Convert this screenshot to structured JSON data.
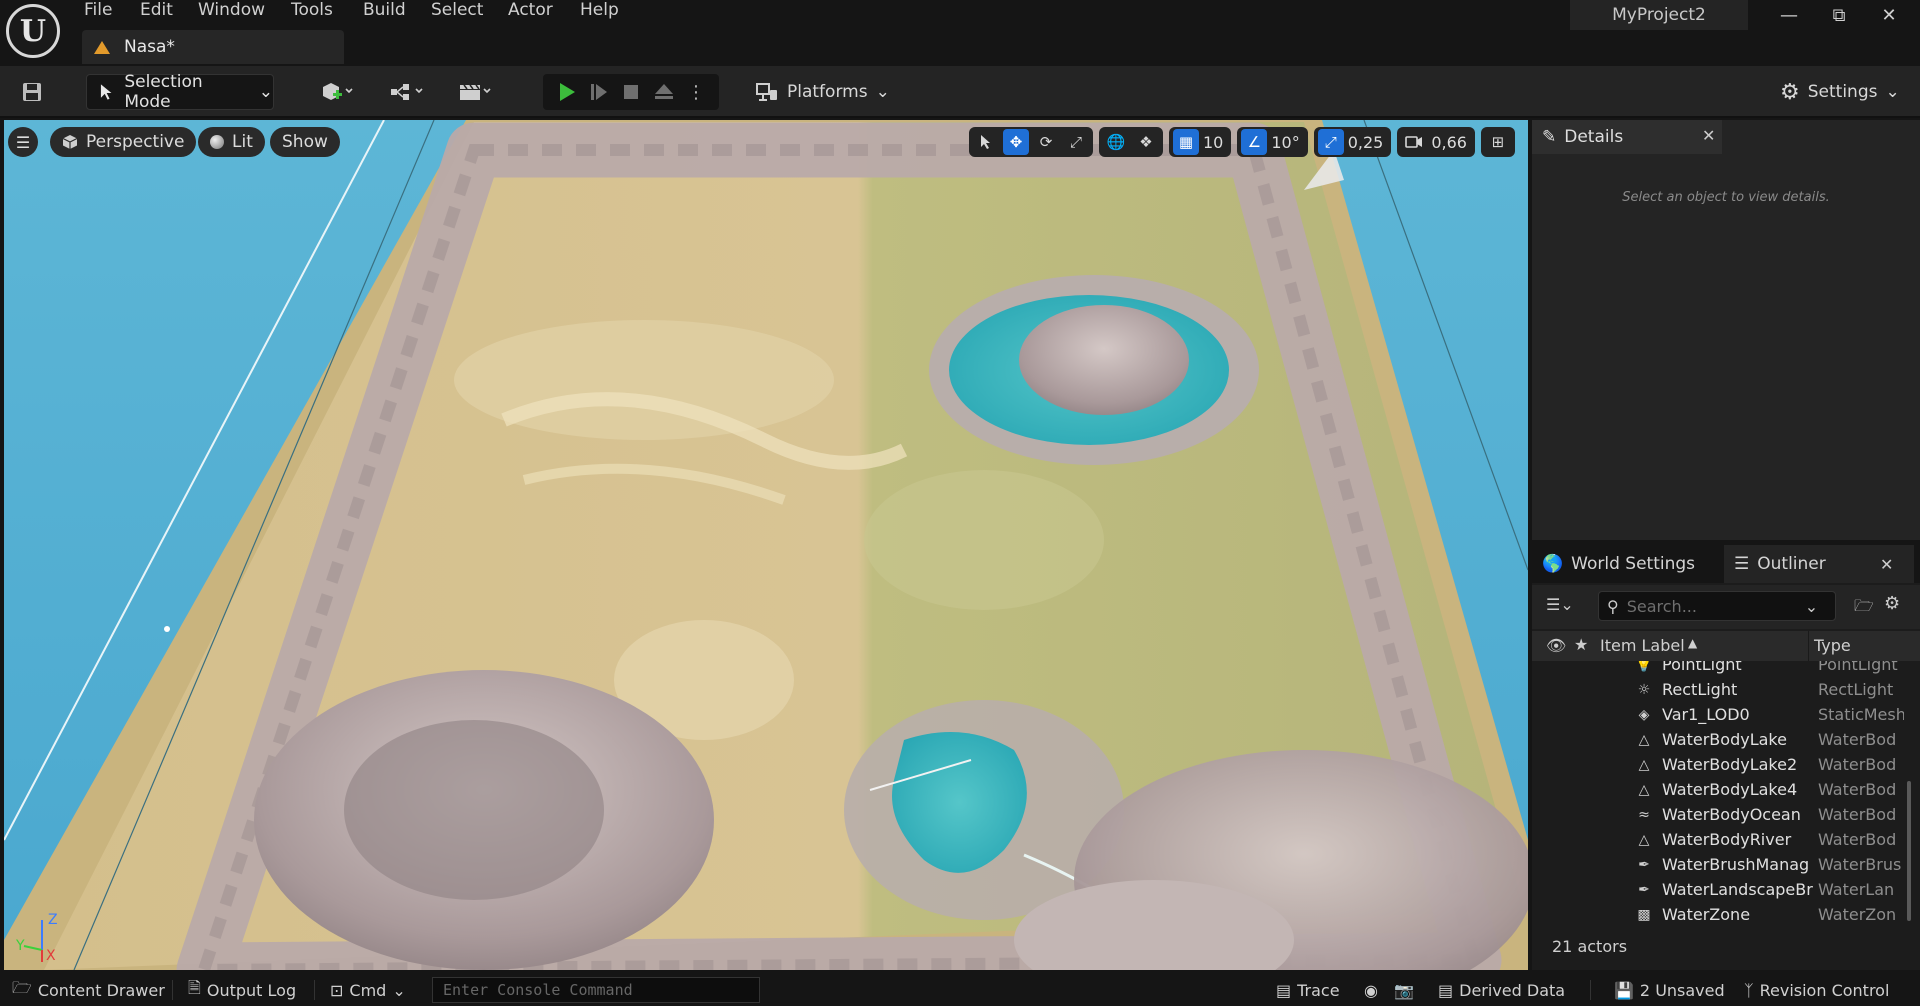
{
  "menu": [
    "File",
    "Edit",
    "Window",
    "Tools",
    "Build",
    "Select",
    "Actor",
    "Help"
  ],
  "level_tab": {
    "label": "Nasa*"
  },
  "project_name": "MyProject2",
  "toolbar": {
    "selection_mode": "Selection Mode",
    "platforms": "Platforms",
    "settings": "Settings"
  },
  "viewport": {
    "perspective": "Perspective",
    "lit": "Lit",
    "show": "Show",
    "grid_snap": "10",
    "rotation_snap": "10°",
    "scale_snap": "0,25",
    "camera_speed": "0,66",
    "axis": {
      "z": "Z",
      "y": "Y",
      "x": "X"
    }
  },
  "details": {
    "tab": "Details",
    "empty_message": "Select an object to view details."
  },
  "outliner": {
    "tabs": [
      "World Settings",
      "Outliner"
    ],
    "search_placeholder": "Search...",
    "col_label": "Item Label",
    "col_type": "Type",
    "rows": [
      {
        "label": "PointLight",
        "type": "PointLight",
        "icon": "pointlight-icon"
      },
      {
        "label": "RectLight",
        "type": "RectLight",
        "icon": "rectlight-icon"
      },
      {
        "label": "Var1_LOD0",
        "type": "StaticMesh",
        "icon": "staticmesh-icon"
      },
      {
        "label": "WaterBodyLake",
        "type": "WaterBod",
        "icon": "waterbody-icon"
      },
      {
        "label": "WaterBodyLake2",
        "type": "WaterBod",
        "icon": "waterbody-icon"
      },
      {
        "label": "WaterBodyLake4",
        "type": "WaterBod",
        "icon": "waterbody-icon"
      },
      {
        "label": "WaterBodyOcean",
        "type": "WaterBod",
        "icon": "waterbody-ocean-icon"
      },
      {
        "label": "WaterBodyRiver",
        "type": "WaterBod",
        "icon": "waterbody-icon"
      },
      {
        "label": "WaterBrushManag",
        "type": "WaterBrus",
        "icon": "waterbrush-icon"
      },
      {
        "label": "WaterLandscapeBr",
        "type": "WaterLan",
        "icon": "waterbrush-icon"
      },
      {
        "label": "WaterZone",
        "type": "WaterZon",
        "icon": "waterzone-icon"
      }
    ],
    "actor_count": "21 actors"
  },
  "statusbar": {
    "content_drawer": "Content Drawer",
    "output_log": "Output Log",
    "cmd": "Cmd",
    "console_placeholder": "Enter Console Command",
    "trace": "Trace",
    "derived_data": "Derived Data",
    "unsaved": "2 Unsaved",
    "revision_control": "Revision Control"
  },
  "colors": {
    "accent": "#1f6fd6",
    "play_green": "#3cbd3c",
    "ocean": "#56b1d4",
    "sand": "#d8c494",
    "grass": "#b8b878",
    "lake": "#3fb8bf",
    "rock": "#b7a9a6",
    "level_icon": "#e29a2b"
  }
}
